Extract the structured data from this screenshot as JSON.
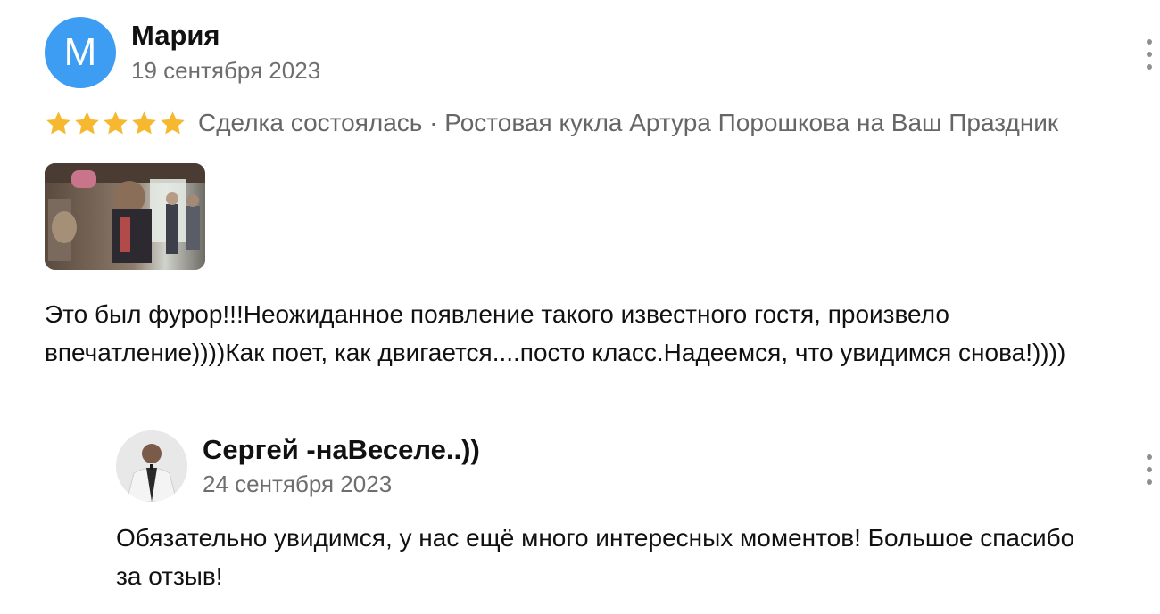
{
  "review": {
    "avatar_letter": "М",
    "author": "Мария",
    "date": "19 сентября 2023",
    "rating": 5,
    "deal_text": "Сделка состоялась · Ростовая кукла Артура Порошкова на Ваш Праздник",
    "text": "Это был фурор!!!Неожиданное появление такого известного гостя, произвело впечатление))))Как поет, как двигается....посто класс.Надеемся, что увидимся снова!))))",
    "avatar_color": "#3d9df2",
    "star_color": "#f5b82e"
  },
  "reply": {
    "author": "Сергей -наВеселе..))",
    "date": "24 сентября 2023",
    "text": "Обязательно увидимся, у нас ещё много интересных моментов! Большое спасибо за отзыв!"
  },
  "icons": {
    "more": "more-vertical-icon",
    "star": "star-icon"
  }
}
